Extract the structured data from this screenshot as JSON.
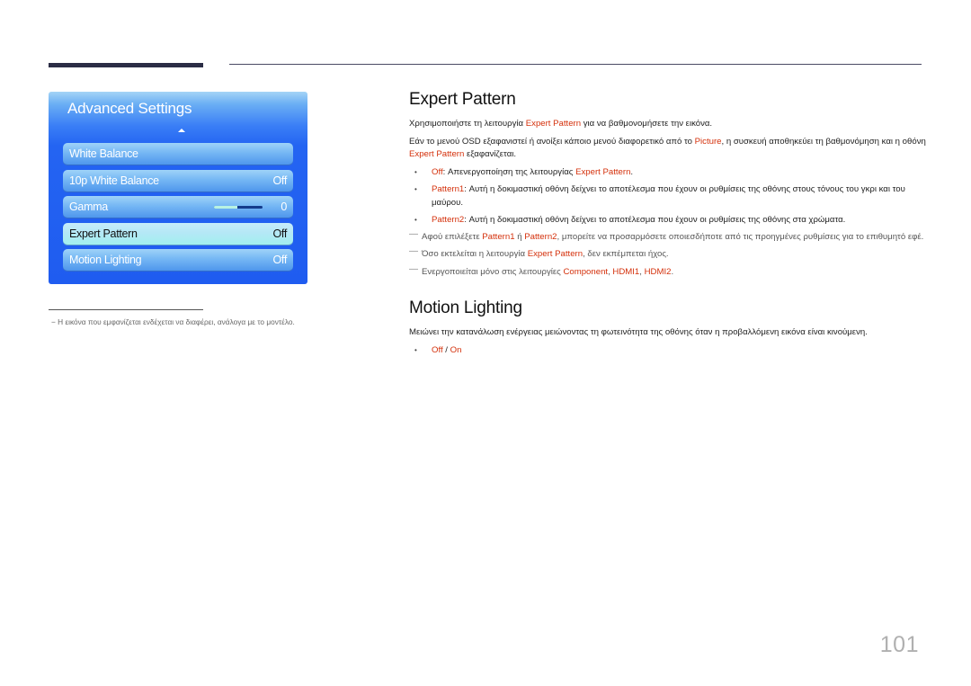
{
  "osd": {
    "title": "Advanced Settings",
    "items": [
      {
        "label": "White Balance",
        "value": ""
      },
      {
        "label": "10p White Balance",
        "value": "Off"
      },
      {
        "label": "Gamma",
        "value": "0",
        "slider_fill_percent": 48
      },
      {
        "label": "Expert Pattern",
        "value": "Off",
        "selected": true
      },
      {
        "label": "Motion Lighting",
        "value": "Off"
      }
    ]
  },
  "figure_note": "− Η εικόνα που εμφανίζεται ενδέχεται να διαφέρει, ανάλογα με το μοντέλο.",
  "expert_pattern": {
    "heading": "Expert Pattern",
    "p1": {
      "a": "Χρησιμοποιήστε τη λειτουργία ",
      "accent": "Expert Pattern",
      "b": " για να βαθμονομήσετε την εικόνα."
    },
    "p2": {
      "a": "Εάν το μενού OSD εξαφανιστεί ή ανοίξει κάποιο μενού διαφορετικό από το ",
      "accent1": "Picture",
      "b": ", η συσκευή αποθηκεύει τη βαθμονόμηση και η οθόνη ",
      "accent2": "Expert Pattern",
      "c": " εξαφανίζεται."
    },
    "bullets": [
      {
        "term": "Off",
        "a": ": Απενεργοποίηση της λειτουργίας ",
        "accent": "Expert Pattern",
        "b": "."
      },
      {
        "term": "Pattern1",
        "a": ": Αυτή η δοκιμαστική οθόνη δείχνει το αποτέλεσμα που έχουν οι ρυθμίσεις της οθόνης στους τόνους του γκρι και του μαύρου.",
        "accent": "",
        "b": ""
      },
      {
        "term": "Pattern2",
        "a": ": Αυτή η δοκιμαστική οθόνη δείχνει το αποτέλεσμα που έχουν οι ρυθμίσεις της οθόνης στα χρώματα.",
        "accent": "",
        "b": ""
      }
    ],
    "notes": [
      {
        "a": "Αφού επιλέξετε ",
        "x1": "Pattern1",
        "b": " ή ",
        "x2": "Pattern2",
        "c": ", μπορείτε να προσαρμόσετε οποιεσδήποτε από τις προηγμένες ρυθμίσεις για το επιθυμητό εφέ."
      },
      {
        "a": "Όσο εκτελείται η λειτουργία ",
        "x1": "Expert Pattern",
        "b": ", δεν εκπέμπεται ήχος.",
        "x2": "",
        "c": ""
      },
      {
        "a": "Ενεργοποιείται μόνο στις λειτουργίες ",
        "x1": "Component",
        "b": ", ",
        "x2": "HDMI1",
        "c": ", ",
        "x3": "HDMI2",
        "d": "."
      }
    ]
  },
  "motion_lighting": {
    "heading": "Motion Lighting",
    "p1": "Μειώνει την κατανάλωση ενέργειας μειώνοντας τη φωτεινότητα της οθόνης όταν η προβαλλόμενη εικόνα είναι κινούμενη.",
    "options": {
      "off": "Off",
      "sep": " / ",
      "on": "On"
    }
  },
  "page_number": "101",
  "colors": {
    "accent": "#d4300b",
    "osd_blue": "#1f5cf0"
  }
}
